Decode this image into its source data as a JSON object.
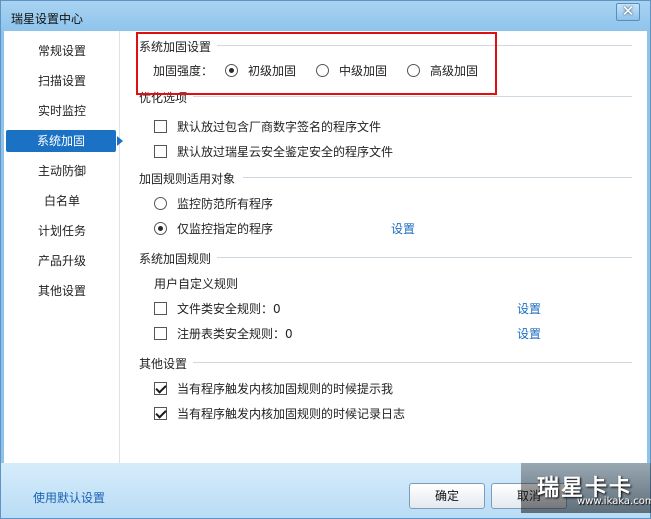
{
  "window": {
    "title": "瑞星设置中心",
    "close_glyph": "✕"
  },
  "sidebar": {
    "items": [
      {
        "label": "常规设置"
      },
      {
        "label": "扫描设置"
      },
      {
        "label": "实时监控"
      },
      {
        "label": "系统加固",
        "active": true
      },
      {
        "label": "主动防御"
      },
      {
        "label": "白名单"
      },
      {
        "label": "计划任务"
      },
      {
        "label": "产品升级"
      },
      {
        "label": "其他设置"
      }
    ]
  },
  "hardening": {
    "title": "系统加固设置",
    "strength_label": "加固强度：",
    "levels": [
      {
        "label": "初级加固",
        "selected": true
      },
      {
        "label": "中级加固",
        "selected": false
      },
      {
        "label": "高级加固",
        "selected": false
      }
    ]
  },
  "optimize": {
    "title": "优化选项",
    "options": [
      {
        "label": "默认放过包含厂商数字签名的程序文件",
        "checked": false
      },
      {
        "label": "默认放过瑞星云安全鉴定安全的程序文件",
        "checked": false
      }
    ]
  },
  "scope": {
    "title": "加固规则适用对象",
    "options": [
      {
        "label": "监控防范所有程序",
        "selected": false
      },
      {
        "label": "仅监控指定的程序",
        "selected": true
      }
    ],
    "settings_link": "设置"
  },
  "rules": {
    "title": "系统加固规则",
    "subtitle": "用户自定义规则",
    "items": [
      {
        "label": "文件类安全规则：0",
        "checked": false,
        "link": "设置"
      },
      {
        "label": "注册表类安全规则：0",
        "checked": false,
        "link": "设置"
      }
    ]
  },
  "other": {
    "title": "其他设置",
    "options": [
      {
        "label": "当有程序触发内核加固规则的时候提示我",
        "checked": true
      },
      {
        "label": "当有程序触发内核加固规则的时候记录日志",
        "checked": true
      }
    ]
  },
  "footer": {
    "default_link": "使用默认设置",
    "ok_label": "确定",
    "cancel_label": "取消"
  },
  "watermark": {
    "text": "瑞星卡卡",
    "url": "www.ikaka.com"
  },
  "colors": {
    "accent": "#1b72c5",
    "link": "#1a6dc2",
    "highlight": "#e01010"
  }
}
